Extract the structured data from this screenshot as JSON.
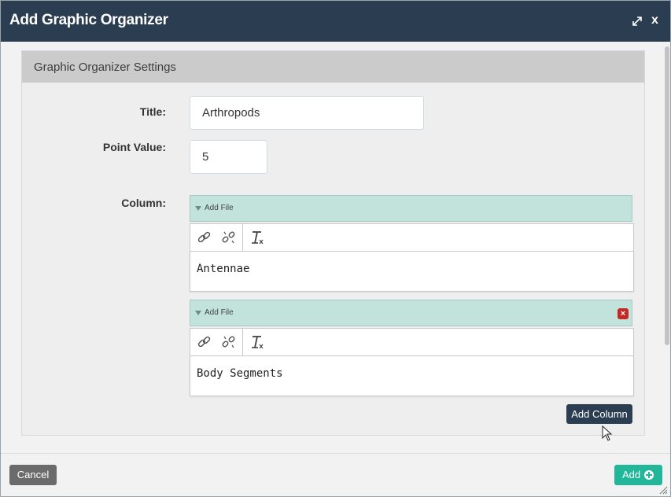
{
  "dialog": {
    "title": "Add Graphic Organizer",
    "close_label": "x",
    "expand_icon": "expand-icon"
  },
  "panel": {
    "header": "Graphic Organizer Settings"
  },
  "form": {
    "title_label": "Title:",
    "title_value": "Arthropods",
    "point_label": "Point Value:",
    "point_value": "5",
    "column_label": "Column:"
  },
  "columns": [
    {
      "add_file_label": "Add File",
      "content": "Antennae",
      "removable": false
    },
    {
      "add_file_label": "Add File",
      "content": "Body Segments",
      "removable": true
    }
  ],
  "toolbar_icons": [
    "link-icon",
    "unlink-icon",
    "remove-format-icon"
  ],
  "buttons": {
    "add_column": "Add Column",
    "cancel": "Cancel",
    "add": "Add"
  },
  "colors": {
    "titlebar": "#2b3d50",
    "file_bar": "#c2e3db",
    "add_button": "#22b79a",
    "cancel_button": "#6b6b6b",
    "remove_icon": "#c42a23"
  }
}
